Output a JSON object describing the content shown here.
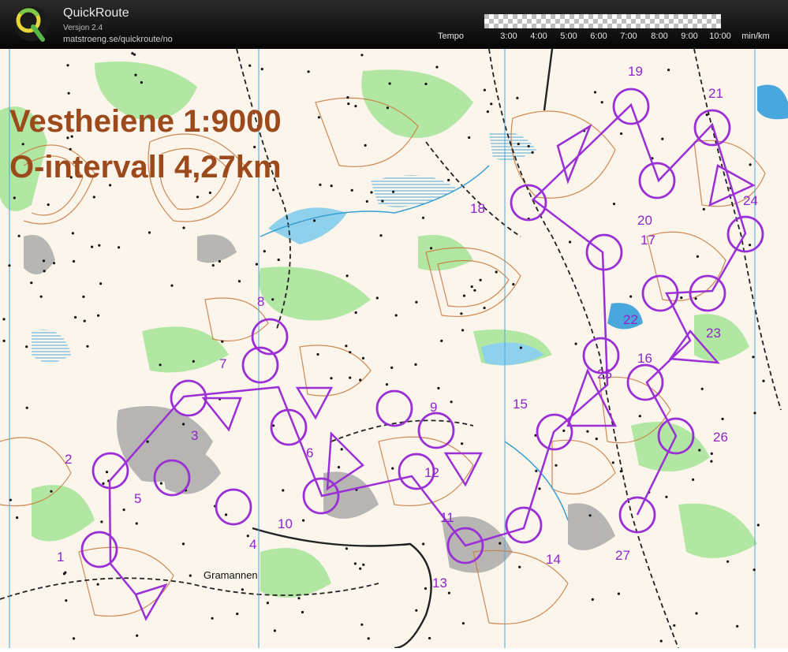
{
  "app": {
    "name": "QuickRoute",
    "version": "Versjon 2.4",
    "url": "matstroeng.se/quickroute/no",
    "logo_letter": "Q"
  },
  "tempo": {
    "label": "Tempo",
    "ticks": [
      "3:00",
      "4:00",
      "5:00",
      "6:00",
      "7:00",
      "8:00",
      "9:00",
      "10:00",
      "min/km"
    ]
  },
  "map": {
    "title_line1": "Vestheiene 1:9000",
    "title_line2": "O-intervall 4,27km",
    "place_name": "Gramannen",
    "colors": {
      "course": "#9b2fd6",
      "title": "#9c4a1c",
      "contour": "#c8773a",
      "vegetation": "#9be08d",
      "water": "#7fc6e6",
      "rock": "#9a9a9a"
    }
  },
  "controls": [
    {
      "number": "1"
    },
    {
      "number": "2"
    },
    {
      "number": "3"
    },
    {
      "number": "4"
    },
    {
      "number": "5"
    },
    {
      "number": "6"
    },
    {
      "number": "7"
    },
    {
      "number": "8"
    },
    {
      "number": "9"
    },
    {
      "number": "10"
    },
    {
      "number": "11"
    },
    {
      "number": "12"
    },
    {
      "number": "13"
    },
    {
      "number": "14"
    },
    {
      "number": "15"
    },
    {
      "number": "16"
    },
    {
      "number": "17"
    },
    {
      "number": "18"
    },
    {
      "number": "19"
    },
    {
      "number": "20"
    },
    {
      "number": "21"
    },
    {
      "number": "22"
    },
    {
      "number": "23"
    },
    {
      "number": "24"
    },
    {
      "number": "25"
    },
    {
      "number": "26"
    },
    {
      "number": "27"
    }
  ]
}
